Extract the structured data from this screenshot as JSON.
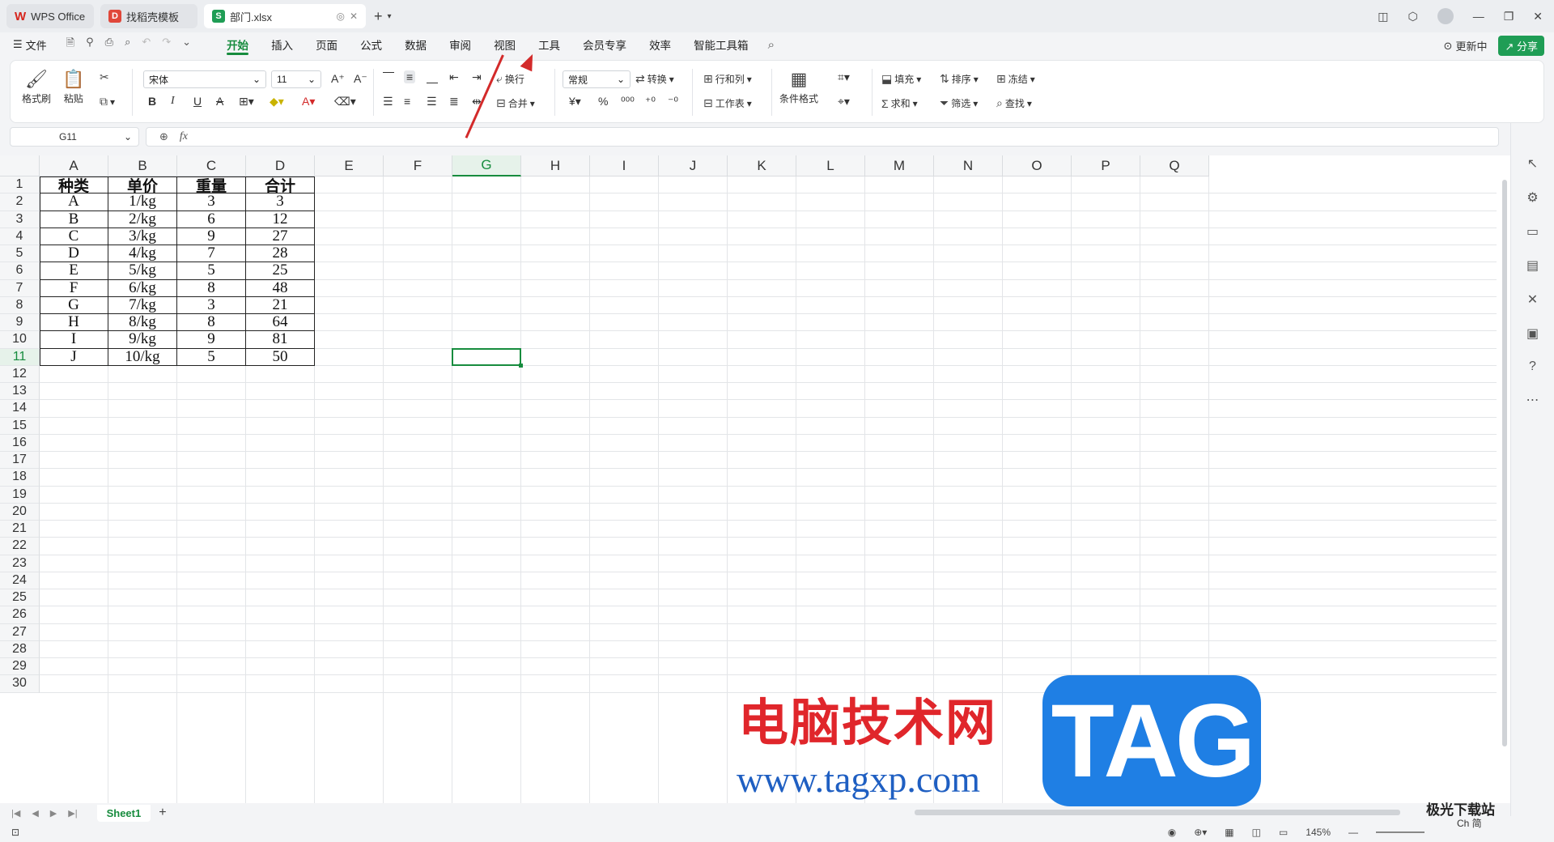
{
  "titlebar": {
    "tabs": [
      {
        "label": "WPS Office"
      },
      {
        "label": "找稻壳模板"
      },
      {
        "label": "部门.xlsx"
      }
    ],
    "new_tab": "+"
  },
  "menubar": {
    "file_label": "文件",
    "tabs": [
      "开始",
      "插入",
      "页面",
      "公式",
      "数据",
      "审阅",
      "视图",
      "工具",
      "会员专享",
      "效率",
      "智能工具箱"
    ],
    "active_tab": "开始",
    "update_label": "更新中",
    "share_label": "分享"
  },
  "ribbon": {
    "format_painter": "格式刷",
    "paste": "粘贴",
    "font_name": "宋体",
    "font_size": "11",
    "wrap": "换行",
    "merge": "合并",
    "number_format": "常规",
    "convert": "转换",
    "row_col": "行和列",
    "worksheet": "工作表",
    "cond_format": "条件格式",
    "fill": "填充",
    "sort": "排序",
    "freeze": "冻结",
    "sum": "求和",
    "filter": "筛选",
    "find": "查找"
  },
  "formulabar": {
    "name_box": "G11",
    "fx": "fx"
  },
  "grid": {
    "columns": [
      "A",
      "B",
      "C",
      "D",
      "E",
      "F",
      "G",
      "H",
      "I",
      "J",
      "K",
      "L",
      "M",
      "N",
      "O",
      "P",
      "Q"
    ],
    "rows": [
      "1",
      "2",
      "3",
      "4",
      "5",
      "6",
      "7",
      "8",
      "9",
      "10",
      "11",
      "12",
      "13",
      "14",
      "15",
      "16",
      "17",
      "18",
      "19",
      "20",
      "21",
      "22",
      "23",
      "24",
      "25",
      "26",
      "27",
      "28",
      "29",
      "30"
    ],
    "selected_column": "G",
    "selected_row": "11",
    "table": [
      [
        "种类",
        "单价",
        "重量",
        "合计"
      ],
      [
        "A",
        "1/kg",
        "3",
        "3"
      ],
      [
        "B",
        "2/kg",
        "6",
        "12"
      ],
      [
        "C",
        "3/kg",
        "9",
        "27"
      ],
      [
        "D",
        "4/kg",
        "7",
        "28"
      ],
      [
        "E",
        "5/kg",
        "5",
        "25"
      ],
      [
        "F",
        "6/kg",
        "8",
        "48"
      ],
      [
        "G",
        "7/kg",
        "3",
        "21"
      ],
      [
        "H",
        "8/kg",
        "8",
        "64"
      ],
      [
        "I",
        "9/kg",
        "9",
        "81"
      ],
      [
        "J",
        "10/kg",
        "5",
        "50"
      ]
    ]
  },
  "sheetbar": {
    "sheet_name": "Sheet1",
    "add": "+"
  },
  "statusbar": {
    "zoom": "145%"
  },
  "watermark": {
    "cn": "电脑技术网",
    "url": "www.tagxp.com",
    "tag": "TAG",
    "corner": "极光下载站",
    "corner2": "Ch 简"
  },
  "colors": {
    "accent": "#178c3e",
    "arrow": "#d32a2a",
    "wm_red": "#e0262b",
    "wm_blue": "#1f7fe4"
  }
}
